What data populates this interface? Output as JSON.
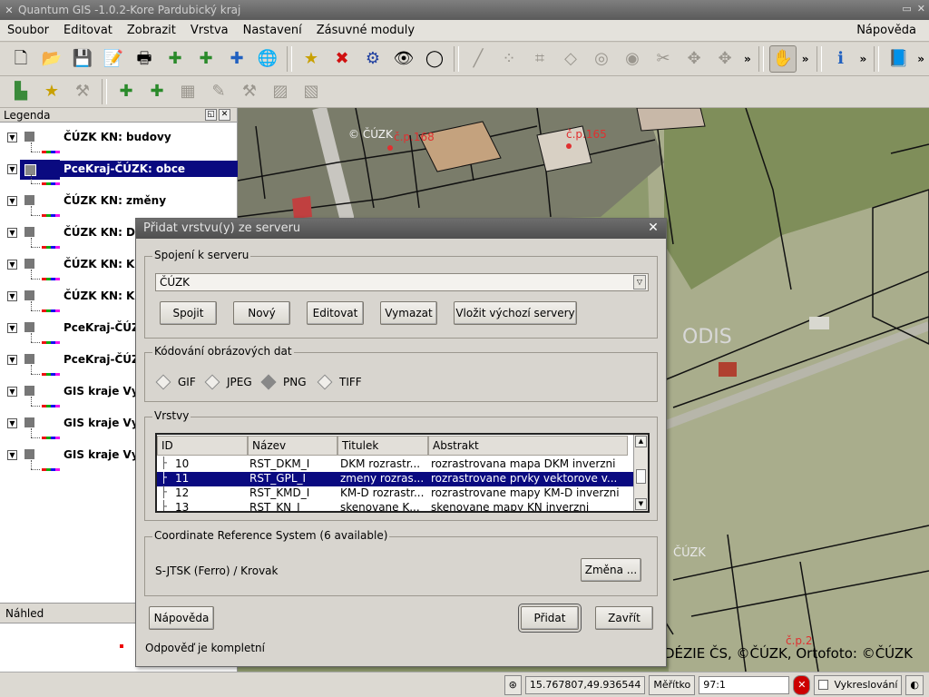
{
  "window": {
    "title": "Quantum GIS -1.0.2-Kore  Pardubický kraj"
  },
  "menu": {
    "items": [
      "Soubor",
      "Editovat",
      "Zobrazit",
      "Vrstva",
      "Nastavení",
      "Zásuvné moduly"
    ],
    "help": "Nápověda"
  },
  "legend": {
    "title": "Legenda",
    "layers": [
      {
        "name": "ČÚZK KN: budovy",
        "selected": false
      },
      {
        "name": "PceKraj-ČÚZK: obce",
        "selected": true
      },
      {
        "name": "ČÚZK KN: změny",
        "selected": false
      },
      {
        "name": "ČÚZK KN: DKM",
        "selected": false
      },
      {
        "name": "ČÚZK KN: KN",
        "selected": false
      },
      {
        "name": "ČÚZK KN: KN i",
        "selected": false
      },
      {
        "name": "PceKraj-ČÚZK",
        "selected": false
      },
      {
        "name": "PceKraj-ČÚZK",
        "selected": false
      },
      {
        "name": "GIS kraje Vysoc",
        "selected": false
      },
      {
        "name": "GIS kraje Vysoc",
        "selected": false
      },
      {
        "name": "GIS kraje Vysoc",
        "selected": false
      }
    ]
  },
  "preview": {
    "title": "Náhled"
  },
  "map": {
    "labels": {
      "copyright_top": "© ČÚZK",
      "cp1": "č.p.168",
      "cp2": "č.p.165",
      "cp3": "č.p.2",
      "zk": "ČÚZK",
      "geodis": "ODIS",
      "footer": "DÉZIE ČS, ©ČÚZK, Ortofoto: ©ČÚZK"
    },
    "colors": {
      "orthophoto": "#8e9a6e",
      "field": "#a9ad8c",
      "lines": "#111111",
      "cp_label": "#e03030"
    }
  },
  "status": {
    "coords": "15.767807,49.936544",
    "scale_label": "Měřítko",
    "scale_value": "97:1",
    "render_label": "Vykreslování"
  },
  "dialog": {
    "title": "Přidat vrstvu(y) ze serveru",
    "server_group": "Spojení k serveru",
    "server_value": "ČÚZK",
    "buttons": {
      "connect": "Spojit",
      "new": "Nový",
      "edit": "Editovat",
      "delete": "Vymazat",
      "defaults": "Vložit výchozí servery",
      "help": "Nápověda",
      "add": "Přidat",
      "close": "Zavřít",
      "change_crs": "Změna ..."
    },
    "encoding_group": "Kódování obrázových dat",
    "encodings": [
      "GIF",
      "JPEG",
      "PNG",
      "TIFF"
    ],
    "layers_group": "Vrstvy",
    "table": {
      "columns": [
        "ID",
        "Název",
        "Titulek",
        "Abstrakt"
      ],
      "rows": [
        {
          "id": "10",
          "name": "RST_DKM_I",
          "title": "DKM rozrastr...",
          "abstract": "rozrastrovana mapa DKM inverzni",
          "selected": false
        },
        {
          "id": "11",
          "name": "RST_GPL_I",
          "title": "zmeny rozras...",
          "abstract": "rozrastrovane prvky vektorove v...",
          "selected": true
        },
        {
          "id": "12",
          "name": "RST_KMD_I",
          "title": "KM-D rozrastr...",
          "abstract": "rozrastrovane mapy KM-D inverzni",
          "selected": false
        },
        {
          "id": "13",
          "name": "RST_KN_I",
          "title": "skenovane K...",
          "abstract": "skenovane mapy KN inverzni",
          "selected": false
        }
      ]
    },
    "crs_group": "Coordinate Reference System (6 available)",
    "crs_value": "S-JTSK (Ferro) / Krovak",
    "status": "Odpověď je kompletní"
  }
}
